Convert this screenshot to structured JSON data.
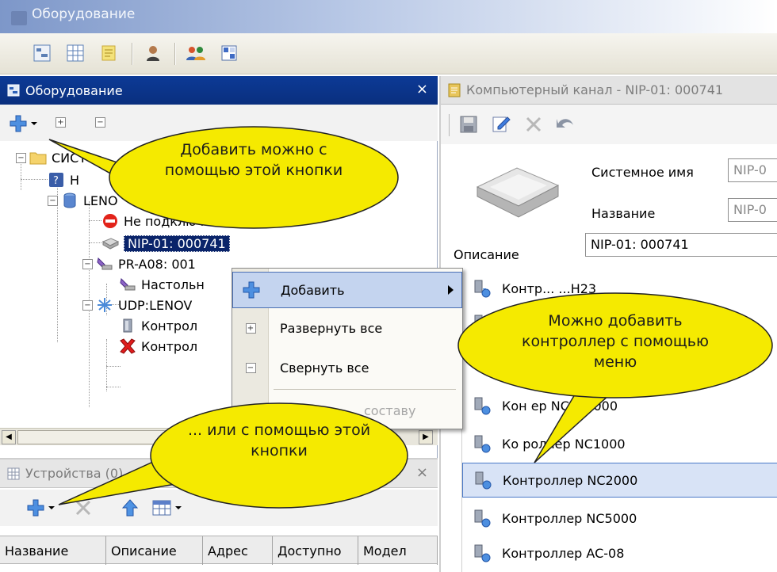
{
  "window": {
    "title": "Оборудование"
  },
  "equipment_panel": {
    "title": "Оборудование",
    "close": "×",
    "tree": [
      {
        "label": "СИСТ"
      },
      {
        "label": "Н"
      },
      {
        "label": "LENO"
      },
      {
        "label": "Не подключены"
      },
      {
        "label": "NIP-01: 000741"
      },
      {
        "label": "PR-A08: 001"
      },
      {
        "label": "Настольн"
      },
      {
        "label": "UDP:LENOV"
      },
      {
        "label": "Контрол"
      },
      {
        "label": "Контрол"
      }
    ]
  },
  "context_menu": {
    "items": [
      {
        "label": "Добавить"
      },
      {
        "label": "Развернуть все"
      },
      {
        "label": "Свернуть все"
      },
      {
        "label": "составу"
      }
    ]
  },
  "devices_panel": {
    "title": "Устройства (0)",
    "close": "×",
    "columns": [
      "Название",
      "Описание",
      "Адрес",
      "Доступно",
      "Модел"
    ]
  },
  "right_panel": {
    "title": "Компьютерный канал - NIP-01: 000741",
    "system_name_label": "Системное имя",
    "system_name_value": "NIP-0",
    "name_label": "Название",
    "name_value": "NIP-0",
    "description_label": "Описание",
    "description_value": "NIP-01: 000741",
    "controllers": [
      {
        "label": "Контр...     ...H23"
      },
      {
        "label": ""
      },
      {
        "label": ""
      },
      {
        "label": "Кон       ер NC100000"
      },
      {
        "label": "Ко    роллер NC1000"
      },
      {
        "label": "Контроллер NC2000"
      },
      {
        "label": "Контроллер NC5000"
      },
      {
        "label": "Контроллер AC-08"
      }
    ]
  },
  "callouts": {
    "add_button": "Добавить можно с помощью этой кнопки",
    "or_button": "... или с помощью этой кнопки",
    "menu": "Можно добавить контроллер с помощью меню"
  },
  "colors": {
    "active_header": "#0a2f7e",
    "callout_fill": "#f5ea00",
    "selection": "#0a246a"
  }
}
